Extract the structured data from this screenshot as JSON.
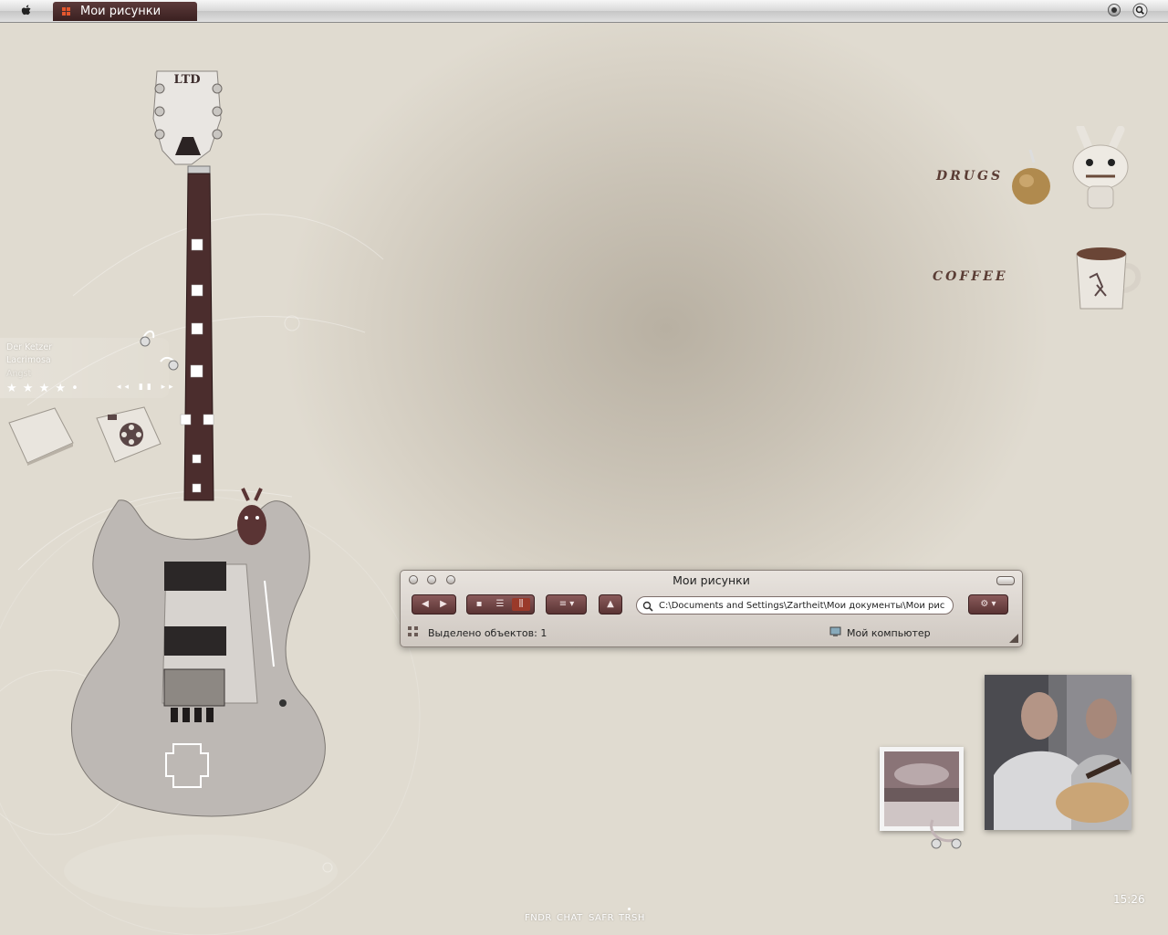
{
  "menubar": {
    "window_title": "Мои рисунки"
  },
  "music_widget": {
    "track": "Der Ketzer",
    "artist": "Lacrimosa",
    "album": "Angst",
    "rating": "★ ★ ★ ★ •",
    "controls": "◂◂ ▮▮ ▸▸"
  },
  "desktop_labels": {
    "drugs": "DRUGS",
    "coffee": "COFFEE"
  },
  "guitar": {
    "headstock_label": "LTD"
  },
  "finder": {
    "title": "Мои рисунки",
    "path": "C:\\Documents and Settings\\Zartheit\\Мои документы\\Мои рис",
    "status_selected": "Выделено объектов: 1",
    "status_location": "Мой компьютер"
  },
  "dock": {
    "items": [
      "FNDR",
      "CHAT",
      "SAFR",
      "TRSH"
    ]
  },
  "clock": {
    "time": "15:26"
  },
  "colors": {
    "accent": "#5a3434",
    "tab_marker": "#e4572e"
  }
}
